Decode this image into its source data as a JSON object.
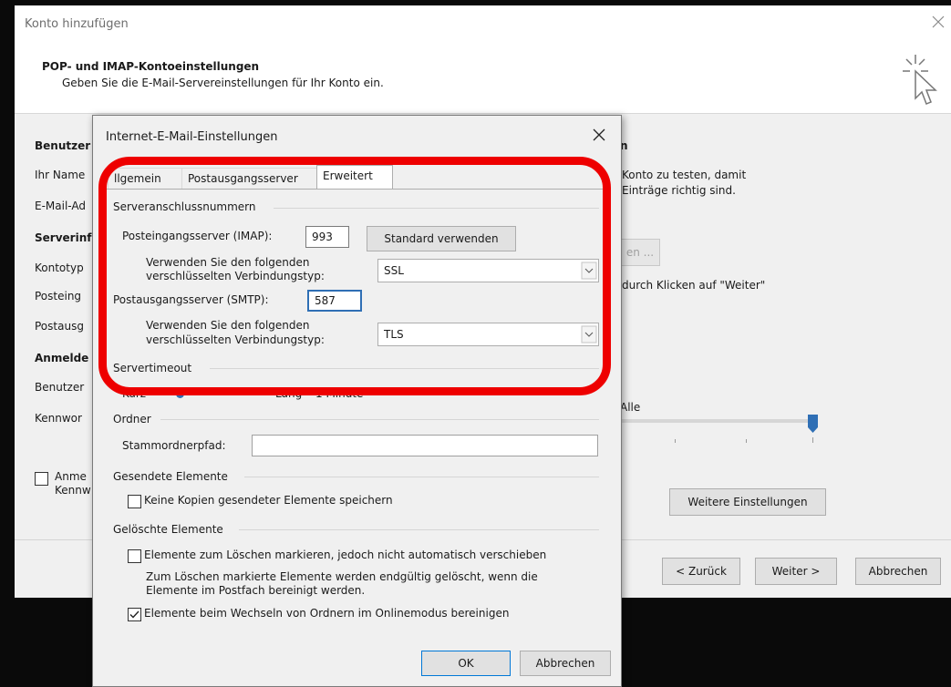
{
  "main": {
    "title": "Konto hinzufügen",
    "heading": "POP- und IMAP-Kontoeinstellungen",
    "subheading": "Geben Sie die E-Mail-Servereinstellungen für Ihr Konto ein.",
    "left_labels": [
      "Benutzer",
      "Ihr Name",
      "E-Mail-Ad",
      "Serverinf",
      "Kontotyp",
      "Posteing",
      "Postausg",
      "Anmelde",
      "Benutzer",
      "Kennwor"
    ],
    "right_heading": "n",
    "right_text1": "Konto zu testen, damit",
    "right_text2": "Einträge richtig sind.",
    "right_btn_fragment": "en ...",
    "right_next_text": "durch Klicken auf \"Weiter\"",
    "slider_label": "Alle",
    "anmelde_check_line1": "Anme",
    "anmelde_check_line2": "Kennw",
    "more_settings": "Weitere Einstellungen",
    "back": "< Zurück",
    "next": "Weiter >",
    "cancel": "Abbrechen"
  },
  "sub": {
    "title": "Internet-E-Mail-Einstellungen",
    "tabs": [
      "llgemein",
      "Postausgangsserver",
      "Erweitert"
    ],
    "group_ports": "Serveranschlussnummern",
    "imap_label": "Posteingangsserver (IMAP):",
    "imap_value": "993",
    "default_btn": "Standard verwenden",
    "enc_label_1": "Verwenden Sie den folgenden",
    "enc_label_2": "verschlüsselten Verbindungstyp:",
    "imap_enc": "SSL",
    "smtp_label": "Postausgangsserver (SMTP):",
    "smtp_value": "587",
    "smtp_enc": "TLS",
    "group_timeout": "Servertimeout",
    "timeout_short": "Kurz",
    "timeout_long": "Lang",
    "timeout_value": "1 Minute",
    "group_folder": "Ordner",
    "root_label": "Stammordnerpfad:",
    "root_value": "",
    "group_sent": "Gesendete Elemente",
    "sent_check": "Keine Kopien gesendeter Elemente speichern",
    "group_deleted": "Gelöschte Elemente",
    "del_check1": "Elemente zum Löschen markieren, jedoch nicht automatisch verschieben",
    "del_note1": "Zum Löschen markierte Elemente werden endgültig gelöscht, wenn die",
    "del_note2": "Elemente im Postfach bereinigt werden.",
    "del_check2": "Elemente beim Wechseln von Ordnern im Onlinemodus bereinigen",
    "ok": "OK",
    "cancel": "Abbrechen"
  },
  "colors": {
    "highlight": "#ee0000",
    "slider": "#2f6fb5"
  }
}
